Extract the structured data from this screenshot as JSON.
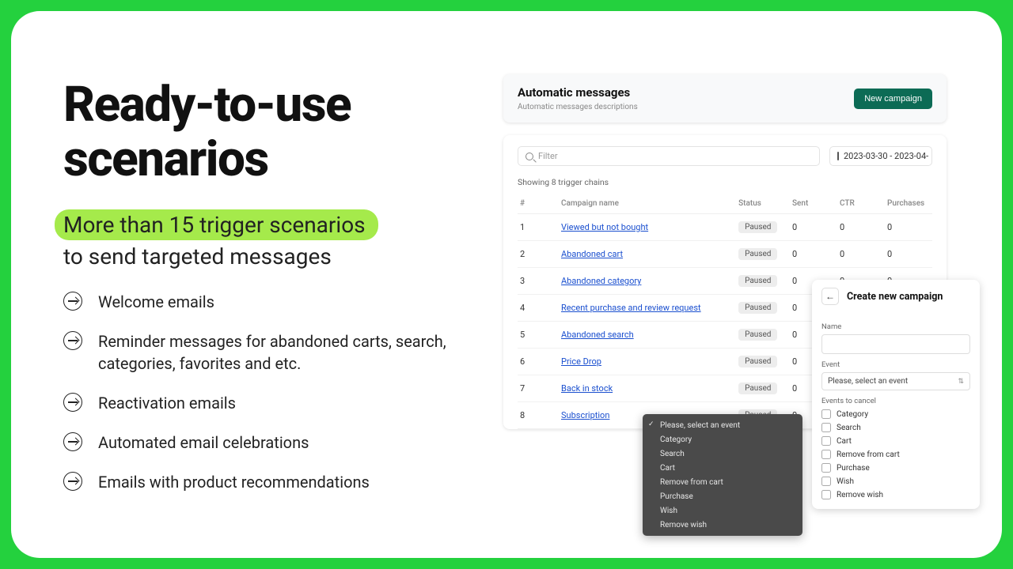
{
  "headline_l1": "Ready-to-use",
  "headline_l2": "scenarios",
  "tag_hl": "More than 15 trigger scenarios",
  "tag_rest": "to send targeted messages",
  "features": [
    "Welcome emails",
    "Reminder messages for abandoned carts, search, categories, favorites and etc.",
    "Reactivation emails",
    "Automated email celebrations",
    "Emails with product recommendations"
  ],
  "app": {
    "title": "Automatic messages",
    "subtitle": "Automatic messages descriptions",
    "new_campaign": "New campaign",
    "filter_placeholder": "Filter",
    "date_range": "2023-03-30 - 2023-04-",
    "showing": "Showing 8 trigger chains",
    "cols": {
      "idx": "#",
      "name": "Campaign name",
      "status": "Status",
      "sent": "Sent",
      "ctr": "CTR",
      "purch": "Purchases"
    },
    "rows": [
      {
        "i": "1",
        "name": "Viewed but not bought",
        "status": "Paused",
        "sent": "0",
        "ctr": "0",
        "purch": "0"
      },
      {
        "i": "2",
        "name": "Abandoned cart",
        "status": "Paused",
        "sent": "0",
        "ctr": "0",
        "purch": "0"
      },
      {
        "i": "3",
        "name": "Abandoned category",
        "status": "Paused",
        "sent": "0",
        "ctr": "0",
        "purch": "0"
      },
      {
        "i": "4",
        "name": "Recent purchase and review request",
        "status": "Paused",
        "sent": "0",
        "ctr": "",
        "purch": ""
      },
      {
        "i": "5",
        "name": "Abandoned search",
        "status": "Paused",
        "sent": "0",
        "ctr": "",
        "purch": ""
      },
      {
        "i": "6",
        "name": "Price Drop",
        "status": "Paused",
        "sent": "0",
        "ctr": "",
        "purch": ""
      },
      {
        "i": "7",
        "name": "Back in stock",
        "status": "Paused",
        "sent": "0",
        "ctr": "",
        "purch": ""
      },
      {
        "i": "8",
        "name": "Subscription",
        "status": "Paused",
        "sent": "0",
        "ctr": "",
        "purch": ""
      }
    ]
  },
  "create": {
    "title": "Create new campaign",
    "name_label": "Name",
    "event_label": "Event",
    "event_placeholder": "Please, select an event",
    "cancel_label": "Events to cancel",
    "cancel_opts": [
      "Category",
      "Search",
      "Cart",
      "Remove from cart",
      "Purchase",
      "Wish",
      "Remove wish"
    ]
  },
  "dropdown": {
    "opts": [
      "Please, select an event",
      "Category",
      "Search",
      "Cart",
      "Remove from cart",
      "Purchase",
      "Wish",
      "Remove wish"
    ]
  }
}
